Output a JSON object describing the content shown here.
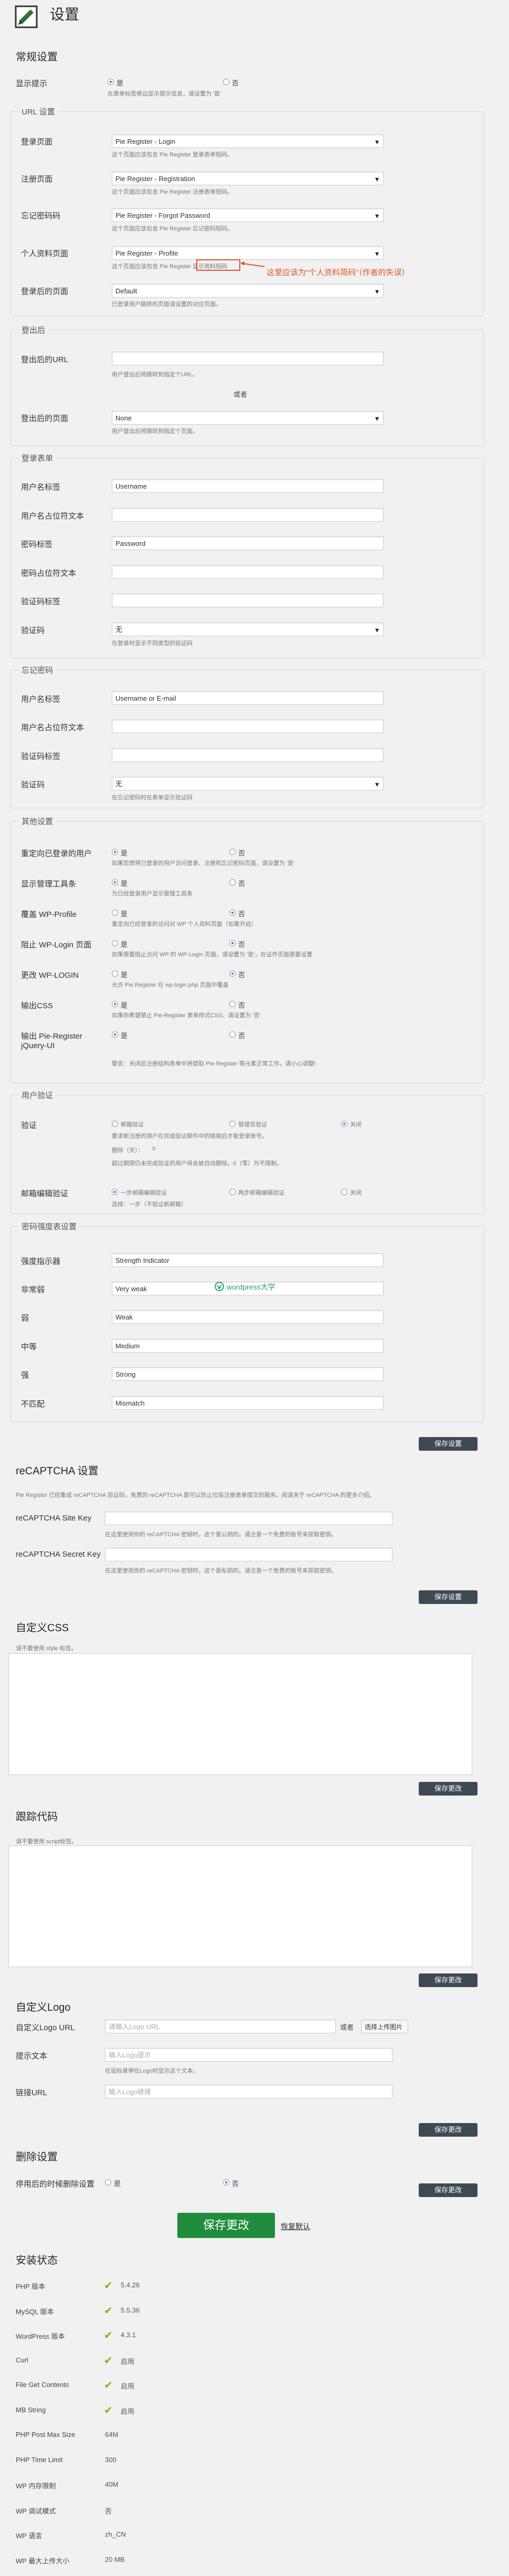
{
  "header": {
    "title": "设置"
  },
  "sections": {
    "general": "常规设置",
    "url": "URL 设置",
    "after_logout": "登出后",
    "login_form": "登录表单",
    "forgot_password": "忘记密码",
    "misc": "其他设置",
    "user_verification": "用户验证",
    "password_strength": "密码强度表设置",
    "recaptcha": "reCAPTCHA 设置",
    "custom_css": "自定义CSS",
    "tracking": "跟踪代码",
    "custom_logo": "自定义Logo",
    "delete": "删除设置",
    "install_status": "安装状态"
  },
  "general": {
    "show_tip_label": "显示提示",
    "yes": "是",
    "no": "否",
    "tip_desc": "在表单标签旁边显示提示信息，请设置为 '是'"
  },
  "url": {
    "login_page_label": "登录页面",
    "login_page_value": "Pie Register - Login",
    "login_desc": "这个页面应该包含 Pie Register 登录表单短码。",
    "register_page_label": "注册页面",
    "register_page_value": "Pie Register - Registration",
    "register_desc": "这个页面应该包含 Pie Register 注册表单短码。",
    "forgot_page_label": "忘记密码码",
    "forgot_page_value": "Pie Register - Forgot Password",
    "forgot_desc": "这个页面应该包含 Pie Register 忘记密码短码。",
    "profile_page_label": "个人资料页面",
    "profile_page_value": "Pie Register - Profile",
    "profile_desc": "这个页面应该包含 Pie Register 显示资料短码",
    "annotation": "这里应该为“个人资料简码”（作者的失误）",
    "after_login_label": "登录后的页面",
    "after_login_value": "Default",
    "after_login_desc": "已登录用户跳转的页面请设置的对应页面。"
  },
  "after_logout": {
    "url_label": "登出后的URL",
    "url_desc": "用户登出后将跳转到指定个URL。",
    "or": "或者",
    "page_label": "登出后的页面",
    "page_value": "None",
    "page_desc": "用户登出后将跳转到指定个页面。"
  },
  "login_form": {
    "username_label": "用户名标签",
    "username_value": "Username",
    "username_ph_label": "用户名占位符文本",
    "password_label": "密码标签",
    "password_value": "Password",
    "password_ph_label": "密码占位符文本",
    "captcha_label_label": "验证码标签",
    "captcha_label": "验证码",
    "captcha_value": "无",
    "captcha_desc": "在登录时显示不同类型的验证码"
  },
  "forgot_password": {
    "username_label": "用户名标签",
    "username_value": "Username or E-mail",
    "username_ph_label": "用户名占位符文本",
    "captcha_label_label": "验证码标签",
    "captcha_label": "验证码",
    "captcha_value": "无",
    "captcha_desc": "在忘记密码时在表单显示验证码"
  },
  "misc": {
    "redirect_label": "重定向已登录的用户",
    "redirect_desc": "如果您想将已登录的用户访问登录、注册和忘记密码页面，请设置为 '是'",
    "show_admin_label": "显示管理工具条",
    "show_admin_desc": "为已经登录用户显示管理工具条",
    "override_label": "覆盖 WP-Profile",
    "override_desc": "重定向已经登录的访问对 WP 个人资料页面（如果开启）",
    "block_label": "阻止 WP-Login 页面",
    "block_desc": "如果需要阻止访问 WP 的 WP-Login 页面，请设置为 '是'，在证件页面需要设置",
    "change_login_label": "更改 WP-LOGIN",
    "change_login_desc": "允许 Pie Register 在 wp-login.php 页面中覆盖",
    "output_css_label": "输出CSS",
    "output_css_desc": "如果你希望禁止 Pie-Register 表单样式CSS，请设置为 '否'",
    "output_jquery_label": "输出 Pie-Register jQuery-UI",
    "output_jquery_desc": "警告：关闭后注册结构表单中将提取 Pie-Register 等元素正常工作，请小心调整!"
  },
  "user_verification": {
    "verify_label": "验证",
    "admin_verify": "邮箱验证",
    "admin_approve": "管理员验证",
    "off": "关闭",
    "verify_desc": "要求新注册的用户在完成验证邮件中的链接后才能登录账号。",
    "days_label": "删除（天）：",
    "days_value": "0",
    "days_desc": "超过期限仍未完成验证的用户将会被自动删除。0（零）为不限制。",
    "email_change_label": "邮箱编辑验证",
    "email_one": "一步邮箱编辑验证",
    "email_two": "两步邮箱编辑验证",
    "email_off": "关闭",
    "email_desc": "选择：一步（不验证新邮箱）"
  },
  "password_strength": {
    "indicator_label": "强度指示器",
    "indicator_value": "Strength Indicator",
    "very_weak_label": "非常弱",
    "very_weak_value": "Very weak",
    "weak_label": "弱",
    "weak_value": "Weak",
    "medium_label": "中等",
    "medium_value": "Medium",
    "strong_label": "强",
    "strong_value": "Strong",
    "mismatch_label": "不匹配",
    "mismatch_value": "Mismatch",
    "watermark": "wordpress大学",
    "save": "保存设置"
  },
  "recaptcha": {
    "intro": "Pie Register 已经集成 reCAPTCHA 验证码，免费的 reCAPTCHA 是可以防止垃圾注册表单提交的服务。阅读关于 reCAPTCHA 的更多介绍。",
    "site_key_label": "reCAPTCHA Site Key",
    "site_key_desc": "在这里使用你的 reCAPTCHA 密钥时，这个是公钥的。请注意一个免费的账号来获取密钥。",
    "secret_key_label": "reCAPTCHA Secret Key",
    "secret_key_desc": "在这里使用你的 reCAPTCHA 密钥时，这个是私钥的。请注意一个免费的账号来获取密钥。",
    "save": "保存设置"
  },
  "custom_css": {
    "hint": "请不要使用 style 标签。",
    "save": "保存更改"
  },
  "tracking": {
    "hint": "请不要使用 script标签。",
    "save": "保存更改"
  },
  "custom_logo": {
    "url_label": "自定义Logo URL",
    "url_placeholder": "请输入Logo URL",
    "or": "或者",
    "upload": "选择上传图片",
    "tooltip_label": "提示文本",
    "tooltip_placeholder": "输入Logo提示",
    "tooltip_desc": "在鼠标悬停在Logo时显示这个文本。",
    "link_label": "链接URL",
    "link_placeholder": "输入Logo链接",
    "save": "保存更改"
  },
  "delete_settings": {
    "label": "停用后的时候删除设置",
    "yes": "是",
    "no": "否",
    "save": "保存更改"
  },
  "footer": {
    "save_all": "保存更改",
    "reset": "恢复默认"
  },
  "install_status": {
    "rows": [
      {
        "label": "PHP 版本",
        "check": true,
        "value": "5.4.26"
      },
      {
        "label": "MySQL 版本",
        "check": true,
        "value": "5.5.36"
      },
      {
        "label": "WordPress 版本",
        "check": true,
        "value": "4.3.1"
      },
      {
        "label": "Curl",
        "check": true,
        "value": "启用"
      },
      {
        "label": "File Get Contents",
        "check": true,
        "value": "启用"
      },
      {
        "label": "MB String",
        "check": true,
        "value": "启用"
      },
      {
        "label": "PHP Post Max Size",
        "check": false,
        "value": "64M"
      },
      {
        "label": "PHP Time Limit",
        "check": false,
        "value": "300"
      },
      {
        "label": "WP 内存限制",
        "check": false,
        "value": "40M"
      },
      {
        "label": "WP 调试模式",
        "check": false,
        "value": "否"
      },
      {
        "label": "WP 语言",
        "check": false,
        "value": "zh_CN"
      },
      {
        "label": "WP 最大上传大小",
        "check": false,
        "value": "20 MB"
      }
    ]
  },
  "colors": {
    "accent": "#1e8cbe",
    "button": "#3e4a52",
    "primary_save": "#1f8d3b",
    "annotation": "#e0542a",
    "check": "#7ab800"
  }
}
